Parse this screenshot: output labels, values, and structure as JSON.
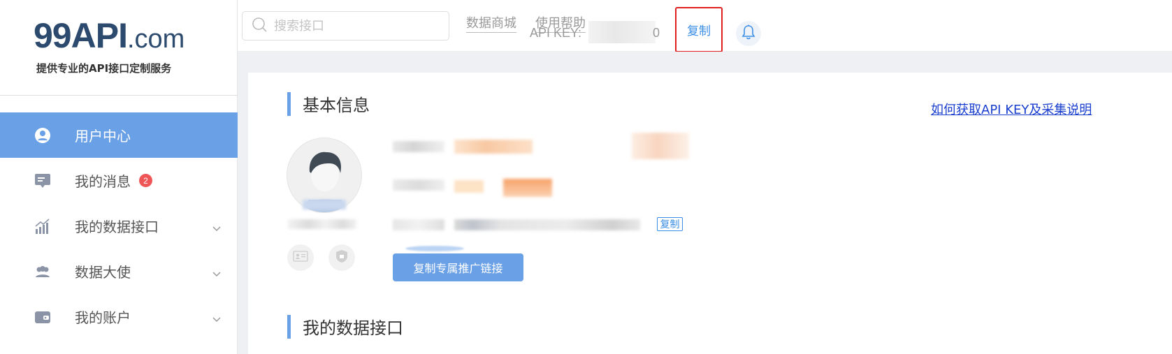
{
  "logo": {
    "main": "99API",
    "suffix": ".com",
    "tagline": "提供专业的API接口定制服务"
  },
  "sidebar": {
    "items": [
      {
        "label": "用户中心",
        "icon": "user-icon",
        "active": true
      },
      {
        "label": "我的消息",
        "icon": "message-icon",
        "badge": "2"
      },
      {
        "label": "我的数据接口",
        "icon": "chart-icon",
        "expandable": true
      },
      {
        "label": "数据大使",
        "icon": "group-icon",
        "expandable": true
      },
      {
        "label": "我的账户",
        "icon": "wallet-icon",
        "expandable": true
      }
    ]
  },
  "topbar": {
    "search_placeholder": "搜索接口",
    "links": [
      "数据商城",
      "使用帮助"
    ],
    "api_key_label": "API KEY:",
    "api_key_tail": "0",
    "copy_label": "复制"
  },
  "content": {
    "basic_info_title": "基本信息",
    "help_link": "如何获取API KEY及采集说明",
    "copy_small_label": "复制",
    "promo_button": "复制专属推广链接",
    "data_api_title": "我的数据接口"
  },
  "colors": {
    "accent": "#6aa0e6",
    "link": "#3a8ee6",
    "badge": "#f05656",
    "highlight_border": "#e02020"
  }
}
